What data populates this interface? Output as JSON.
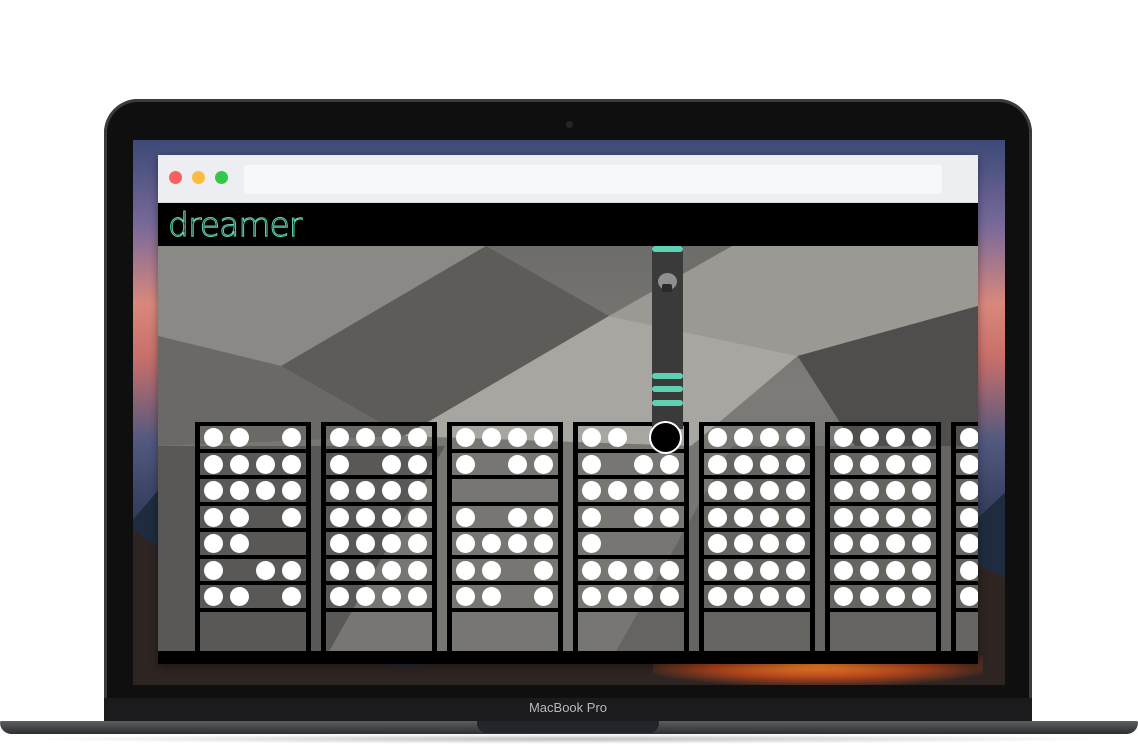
{
  "device": {
    "brand_label": "MacBook Pro"
  },
  "browser": {
    "address_value": ""
  },
  "app": {
    "logo_text": "dreamer"
  },
  "game": {
    "shelves": [
      {
        "rows": [
          [
            1,
            1,
            0,
            1
          ],
          [
            1,
            1,
            1,
            1
          ],
          [
            1,
            1,
            1,
            1
          ],
          [
            1,
            1,
            0,
            1
          ],
          [
            1,
            1,
            0,
            0
          ],
          [
            1,
            0,
            1,
            1
          ],
          [
            1,
            1,
            0,
            1
          ]
        ]
      },
      {
        "rows": [
          [
            1,
            1,
            1,
            1
          ],
          [
            1,
            0,
            1,
            1
          ],
          [
            1,
            1,
            1,
            1
          ],
          [
            1,
            1,
            1,
            1
          ],
          [
            1,
            1,
            1,
            1
          ],
          [
            1,
            1,
            1,
            1
          ],
          [
            1,
            1,
            1,
            1
          ]
        ]
      },
      {
        "rows": [
          [
            1,
            1,
            1,
            1
          ],
          [
            1,
            0,
            1,
            1
          ],
          [
            0,
            0,
            0,
            0
          ],
          [
            1,
            0,
            1,
            1
          ],
          [
            1,
            1,
            1,
            1
          ],
          [
            1,
            1,
            0,
            1
          ],
          [
            1,
            1,
            0,
            1
          ]
        ]
      },
      {
        "rows": [
          [
            1,
            1,
            0,
            0
          ],
          [
            1,
            0,
            1,
            1
          ],
          [
            1,
            1,
            1,
            1
          ],
          [
            1,
            0,
            1,
            1
          ],
          [
            1,
            0,
            0,
            0
          ],
          [
            1,
            1,
            1,
            1
          ],
          [
            1,
            1,
            1,
            1
          ]
        ]
      },
      {
        "rows": [
          [
            1,
            1,
            1,
            1
          ],
          [
            1,
            1,
            1,
            1
          ],
          [
            1,
            1,
            1,
            1
          ],
          [
            1,
            1,
            1,
            1
          ],
          [
            1,
            1,
            1,
            1
          ],
          [
            1,
            1,
            1,
            1
          ],
          [
            1,
            1,
            1,
            1
          ]
        ]
      },
      {
        "rows": [
          [
            1,
            1,
            1,
            1
          ],
          [
            1,
            1,
            1,
            1
          ],
          [
            1,
            1,
            1,
            1
          ],
          [
            1,
            1,
            1,
            1
          ],
          [
            1,
            1,
            1,
            1
          ],
          [
            1,
            1,
            1,
            1
          ],
          [
            1,
            1,
            1,
            1
          ]
        ]
      },
      {
        "rows": [
          [
            1,
            0,
            0,
            0
          ],
          [
            1,
            0,
            0,
            0
          ],
          [
            1,
            0,
            0,
            0
          ],
          [
            1,
            0,
            0,
            0
          ],
          [
            1,
            0,
            0,
            0
          ],
          [
            1,
            0,
            0,
            0
          ],
          [
            1,
            0,
            0,
            0
          ]
        ]
      }
    ]
  }
}
